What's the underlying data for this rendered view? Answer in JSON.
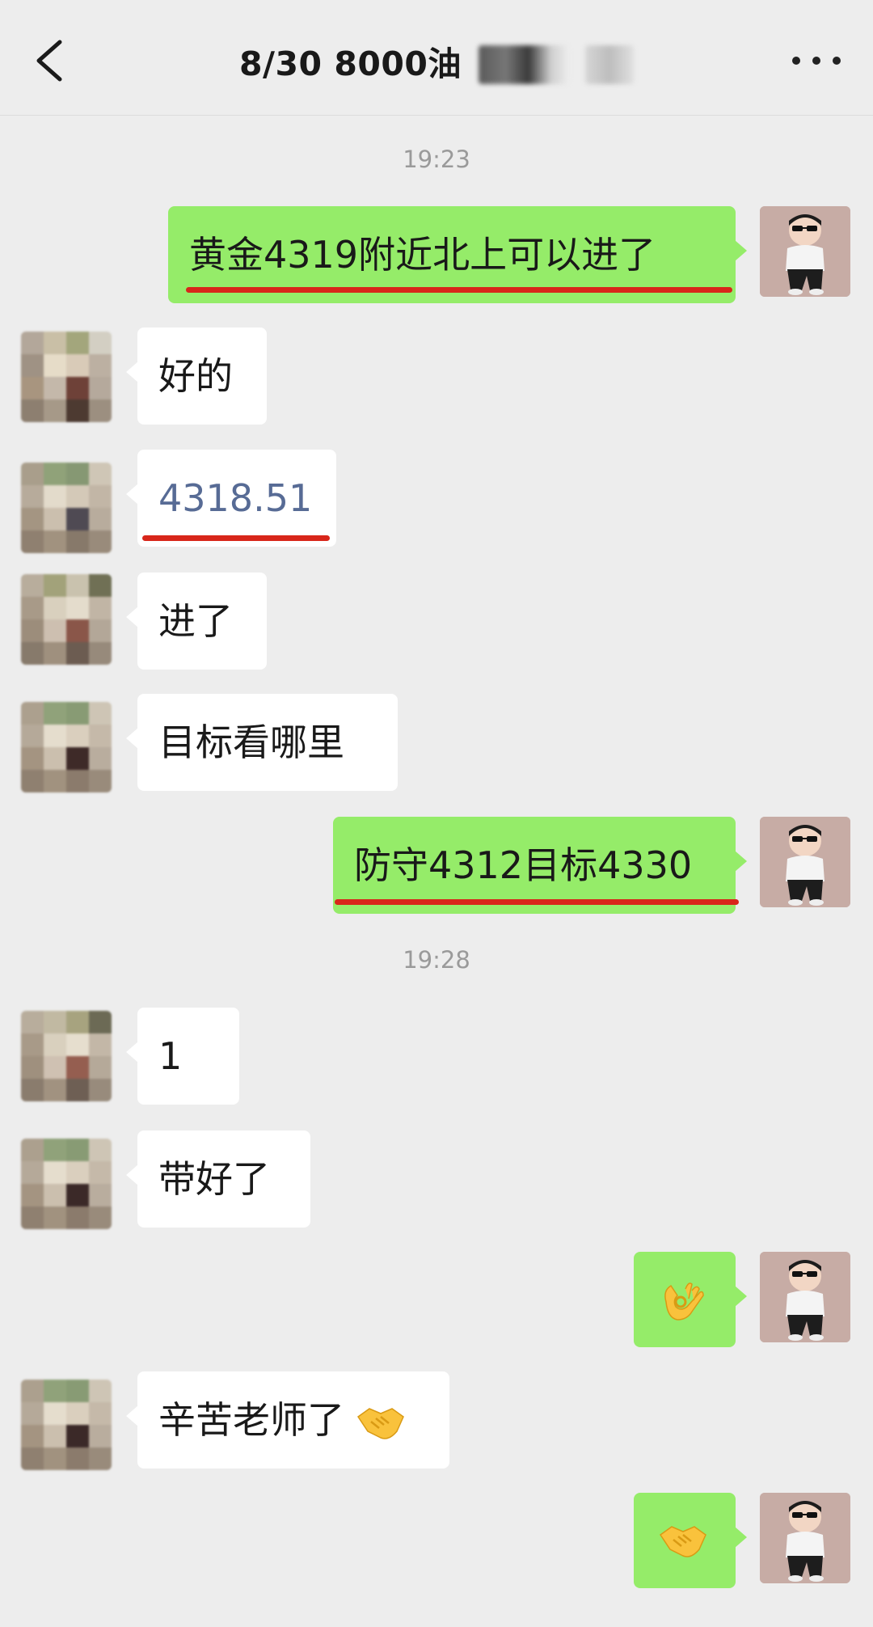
{
  "header": {
    "title": "8/30  8000油",
    "back_icon": "chevron-left-icon",
    "more_icon": "more-dots-icon"
  },
  "messages": {
    "time1": "19:23",
    "m1": "黄金4319附近北上可以进了",
    "m2": "好的",
    "m3": "4318.51",
    "m4": "进了",
    "m5": "目标看哪里",
    "m6": "防守4312目标4330",
    "time2": "19:28",
    "m7": "1",
    "m8": "带好了",
    "m9_icon": "ok-hand-emoji",
    "m10": "辛苦老师了",
    "m10_icon": "handshake-emoji",
    "m11_icon": "handshake-emoji"
  },
  "colors": {
    "outgoing_bubble": "#95ec69",
    "incoming_bubble": "#ffffff",
    "link_text": "#576b95",
    "underline_mark": "#d8261a",
    "background": "#ededed"
  }
}
